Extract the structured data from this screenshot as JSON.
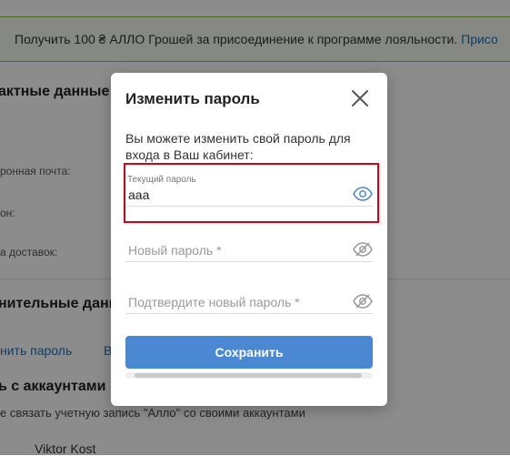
{
  "promo": {
    "text": "Получить 100 ₴ АЛЛО Грошей за присоединение к программе лояльности.",
    "link": "Присо"
  },
  "background": {
    "contact_title": "актные данные",
    "email_label": "ронная почта:",
    "phone_label": "он:",
    "delivery_label": "а доставок:",
    "additional_title": "нительные данн",
    "change_password_link": "нить пароль",
    "other_link": "В",
    "accounts_title": "ь с аккаунтами",
    "accounts_desc": "е связать учетную запись \"Алло\" со своими аккаунтами",
    "account_name": "Viktor Kost"
  },
  "modal": {
    "title": "Изменить пароль",
    "description": "Вы можете изменить свой пароль для входа в Ваш кабинет:",
    "current": {
      "label": "Текущий пароль",
      "value": "aaa"
    },
    "new": {
      "placeholder": "Новый пароль *"
    },
    "confirm": {
      "placeholder": "Подтвердите новый пароль *"
    },
    "save_label": "Сохранить",
    "icons": {
      "close": "close-icon",
      "visible": "eye-icon",
      "hidden": "eye-off-icon"
    },
    "colors": {
      "primary": "#4a88d1",
      "highlight": "#d0021b",
      "eye_active": "#4a88d1"
    }
  }
}
